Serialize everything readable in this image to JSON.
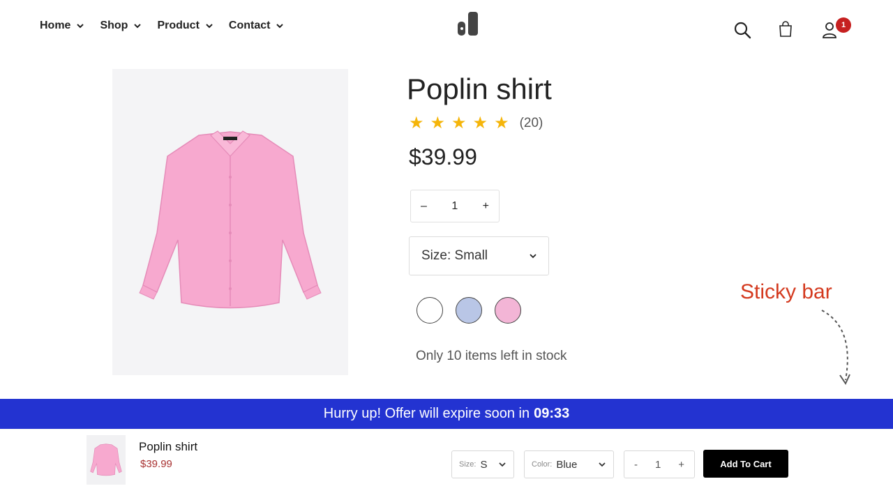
{
  "header": {
    "nav": [
      {
        "label": "Home"
      },
      {
        "label": "Shop"
      },
      {
        "label": "Product"
      },
      {
        "label": "Contact"
      }
    ],
    "cart_badge": "1"
  },
  "product": {
    "title": "Poplin shirt",
    "rating": 5,
    "review_count": "(20)",
    "price": "$39.99",
    "quantity": "1",
    "qty_minus": "–",
    "qty_plus": "+",
    "size_label": "Size: Small",
    "swatches": [
      {
        "name": "white",
        "color": "#ffffff"
      },
      {
        "name": "blue",
        "color": "#b9c6e6"
      },
      {
        "name": "pink",
        "color": "#f3b5d6"
      }
    ],
    "stock_text": "Only 10 items left in stock"
  },
  "annotation": {
    "label": "Sticky bar"
  },
  "offer_bar": {
    "text": "Hurry up! Offer will expire soon in",
    "countdown": "09:33",
    "color": "#2333d1"
  },
  "sticky_bar": {
    "name": "Poplin shirt",
    "price": "$39.99",
    "size_label": "Size:",
    "size_value": "S",
    "color_label": "Color:",
    "color_value": "Blue",
    "qty_minus": "-",
    "qty_value": "1",
    "qty_plus": "+",
    "add_button": "Add To Cart"
  },
  "colors": {
    "accent_red": "#d43a1f",
    "star": "#f5b50a",
    "shirt_pink": "#f7a9cf"
  }
}
